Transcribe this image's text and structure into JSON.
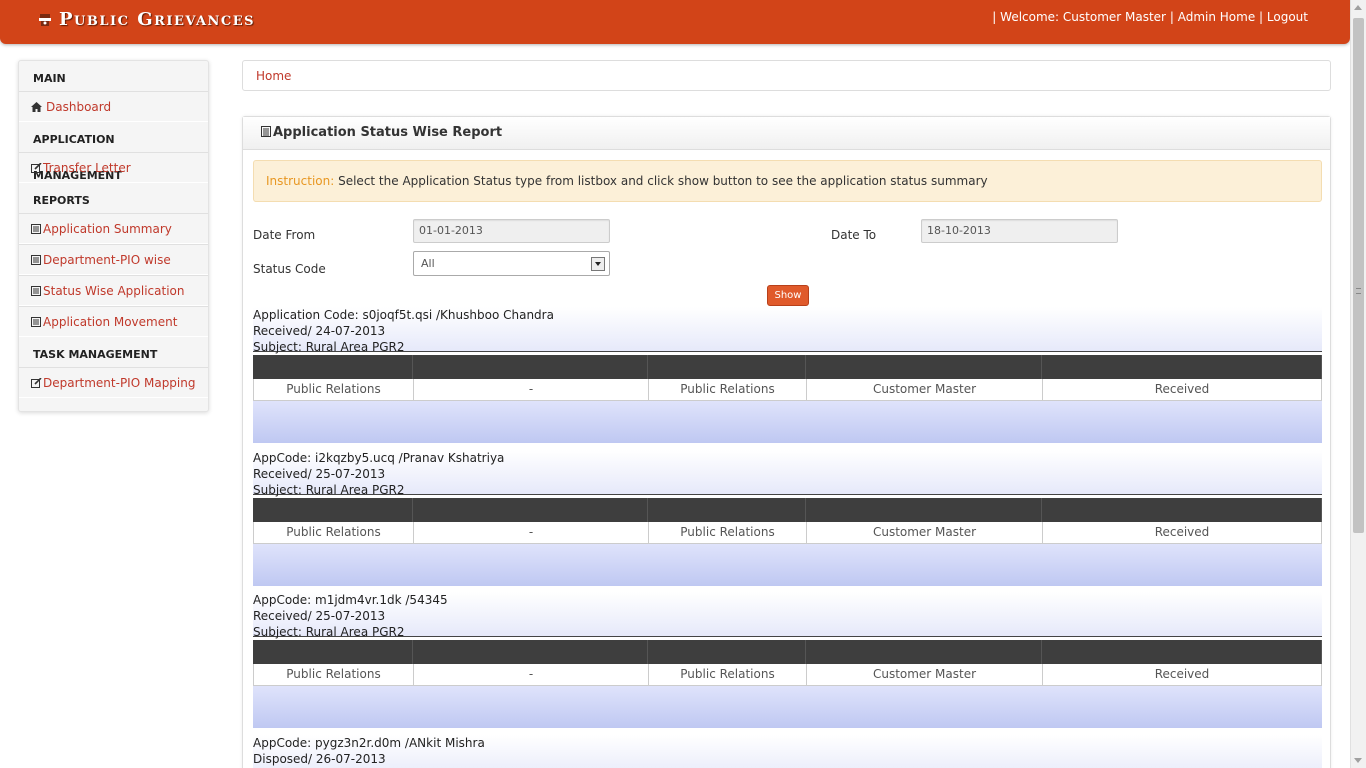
{
  "header": {
    "brand": "Public Grievances",
    "user_links": {
      "sep1": "|",
      "welcome": "Welcome: Customer Master",
      "sep2": "|",
      "admin_home": "Admin Home",
      "sep3": "|",
      "logout": "Logout"
    }
  },
  "sidebar": {
    "sections": [
      {
        "title": "MAIN",
        "items": [
          {
            "label": "Dashboard",
            "icon": "home-icon"
          }
        ]
      },
      {
        "title": "APPLICATION MANAGEMENT",
        "items": [
          {
            "label": "Transfer Letter",
            "icon": "edit-icon"
          }
        ]
      },
      {
        "title": "REPORTS",
        "items": [
          {
            "label": "Application Summary",
            "icon": "list-icon"
          },
          {
            "label": "Department-PIO wise",
            "icon": "list-icon"
          },
          {
            "label": "Status Wise Application",
            "icon": "list-icon"
          },
          {
            "label": "Application Movement",
            "icon": "list-icon"
          }
        ]
      },
      {
        "title": "TASK MANAGEMENT",
        "items": [
          {
            "label": "Department-PIO Mapping",
            "icon": "edit-icon"
          }
        ]
      }
    ]
  },
  "breadcrumb": {
    "home": "Home"
  },
  "report": {
    "title": "Application Status Wise Report",
    "instruction_label": "Instruction:",
    "instruction_text": " Select the Application Status type from listbox and click show button to see the application status summary",
    "date_from_label": "Date From",
    "date_from_value": "01-01-2013",
    "date_to_label": "Date To",
    "date_to_value": "18-10-2013",
    "status_code_label": "Status Code",
    "status_code_value": "All",
    "show_button": "Show"
  },
  "records": [
    {
      "code_line": "Application Code: s0joqf5t.qsi /Khushboo Chandra",
      "received_line": "Received/ 24-07-2013",
      "subject_line": "Subject: Rural Area PGR2",
      "row": [
        "Public Relations",
        "-",
        "Public Relations",
        "Customer Master",
        "Received"
      ]
    },
    {
      "code_line": "AppCode: i2kqzby5.ucq /Pranav Kshatriya",
      "received_line": "Received/ 25-07-2013",
      "subject_line": "Subject: Rural Area PGR2",
      "row": [
        "Public Relations",
        "-",
        "Public Relations",
        "Customer Master",
        "Received"
      ]
    },
    {
      "code_line": "AppCode: m1jdm4vr.1dk /54345",
      "received_line": "Received/ 25-07-2013",
      "subject_line": "Subject: Rural Area PGR2",
      "row": [
        "Public Relations",
        "-",
        "Public Relations",
        "Customer Master",
        "Received"
      ]
    },
    {
      "code_line": "AppCode: pygz3n2r.d0m /ANkit Mishra",
      "received_line": "Disposed/ 26-07-2013"
    }
  ]
}
